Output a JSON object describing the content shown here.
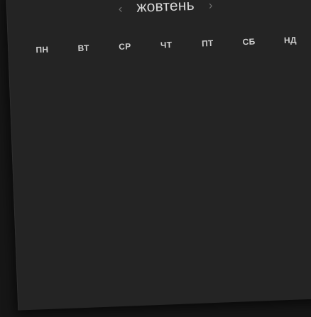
{
  "calendar": {
    "month": "жовтень",
    "prev_icon": "chevron-left-icon",
    "next_icon": "chevron-right-icon",
    "prev_glyph": "‹",
    "next_glyph": "›",
    "weekdays": [
      "ПН",
      "ВТ",
      "СР",
      "ЧТ",
      "ПТ",
      "СБ",
      "НД"
    ]
  },
  "colors": {
    "background": "#242424",
    "month_text": "#d6d6d6",
    "weekday_text": "#cfcfcf",
    "nav_arrow": "#6f6f6f"
  }
}
